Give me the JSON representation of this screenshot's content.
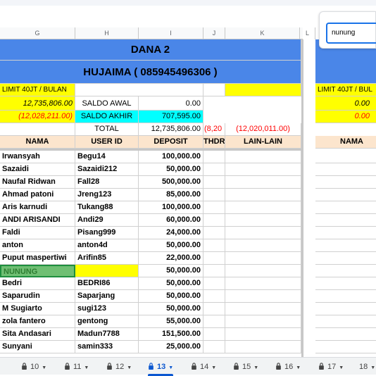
{
  "colors": {
    "blue": "#4a86e8",
    "yellow": "#ffff00",
    "cyan": "#00ffff",
    "peach": "#fce5cd",
    "green": "#6fbf73",
    "red": "#ff0000",
    "active_tab": "#0b57d0"
  },
  "columns": [
    "G",
    "H",
    "I",
    "J",
    "K",
    "L"
  ],
  "search": {
    "value": "nunung"
  },
  "sheet": {
    "title": "DANA 2",
    "subtitle": "HUJAIMA ( 085945496306 )",
    "limit_label": "LIMIT 40JT / BULAN",
    "limit_label_right": "LIMIT 40JT / BUL",
    "val1": "12,735,806.00",
    "val2": "(12,028,211.00)",
    "right_val1": "0.00",
    "right_val2": "0.00",
    "saldo_awal_label": "SALDO AWAL",
    "saldo_awal": "0.00",
    "saldo_akhir_label": "SALDO AKHIR",
    "saldo_akhir": "707,595.00",
    "total_label": "TOTAL",
    "total_deposit": "12,735,806.00",
    "total_withdraw": "(8,20",
    "total_lain": "(12,020,011.00)",
    "headers": {
      "nama": "NAMA",
      "user_id": "USER ID",
      "deposit": "DEPOSIT",
      "withdraw": "THDRA",
      "lain": "LAIN-LAIN",
      "nama_right": "NAMA"
    }
  },
  "rows": [
    {
      "nama": "Irwansyah",
      "user_id": "Begu14",
      "deposit": "100,000.00"
    },
    {
      "nama": "Sazaidi",
      "user_id": "Sazaidi212",
      "deposit": "50,000.00"
    },
    {
      "nama": "Naufal Ridwan",
      "user_id": "Fall28",
      "deposit": "500,000.00"
    },
    {
      "nama": "Ahmad patoni",
      "user_id": "Jreng123",
      "deposit": "85,000.00"
    },
    {
      "nama": "Aris karnudi",
      "user_id": "Tukang88",
      "deposit": "100,000.00"
    },
    {
      "nama": "ANDI ARISANDI",
      "user_id": "Andi29",
      "deposit": "60,000.00"
    },
    {
      "nama": "Faldi",
      "user_id": "Pisang999",
      "deposit": "24,000.00"
    },
    {
      "nama": "anton",
      "user_id": "anton4d",
      "deposit": "50,000.00"
    },
    {
      "nama": "Puput maspertiwi",
      "user_id": "Arifin85",
      "deposit": "22,000.00"
    },
    {
      "nama": "NUNUNG",
      "user_id": "",
      "deposit": "50,000.00",
      "highlight": true
    },
    {
      "nama": "Bedri",
      "user_id": "BEDRI86",
      "deposit": "50,000.00"
    },
    {
      "nama": "Saparudin",
      "user_id": "Saparjang",
      "deposit": "50,000.00"
    },
    {
      "nama": "M Sugiarto",
      "user_id": "sugi123",
      "deposit": "50,000.00"
    },
    {
      "nama": "zola fantero",
      "user_id": "gentong",
      "deposit": "55,000.00"
    },
    {
      "nama": "Sita Andasari",
      "user_id": "Madun7788",
      "deposit": "151,500.00"
    },
    {
      "nama": "Sunyani",
      "user_id": "samin333",
      "deposit": "25,000.00"
    }
  ],
  "tabs": [
    {
      "label": "10",
      "active": false
    },
    {
      "label": "11",
      "active": false
    },
    {
      "label": "12",
      "active": false
    },
    {
      "label": "13",
      "active": true
    },
    {
      "label": "14",
      "active": false
    },
    {
      "label": "15",
      "active": false
    },
    {
      "label": "16",
      "active": false
    },
    {
      "label": "17",
      "active": false
    },
    {
      "label": "18",
      "active": false
    }
  ]
}
